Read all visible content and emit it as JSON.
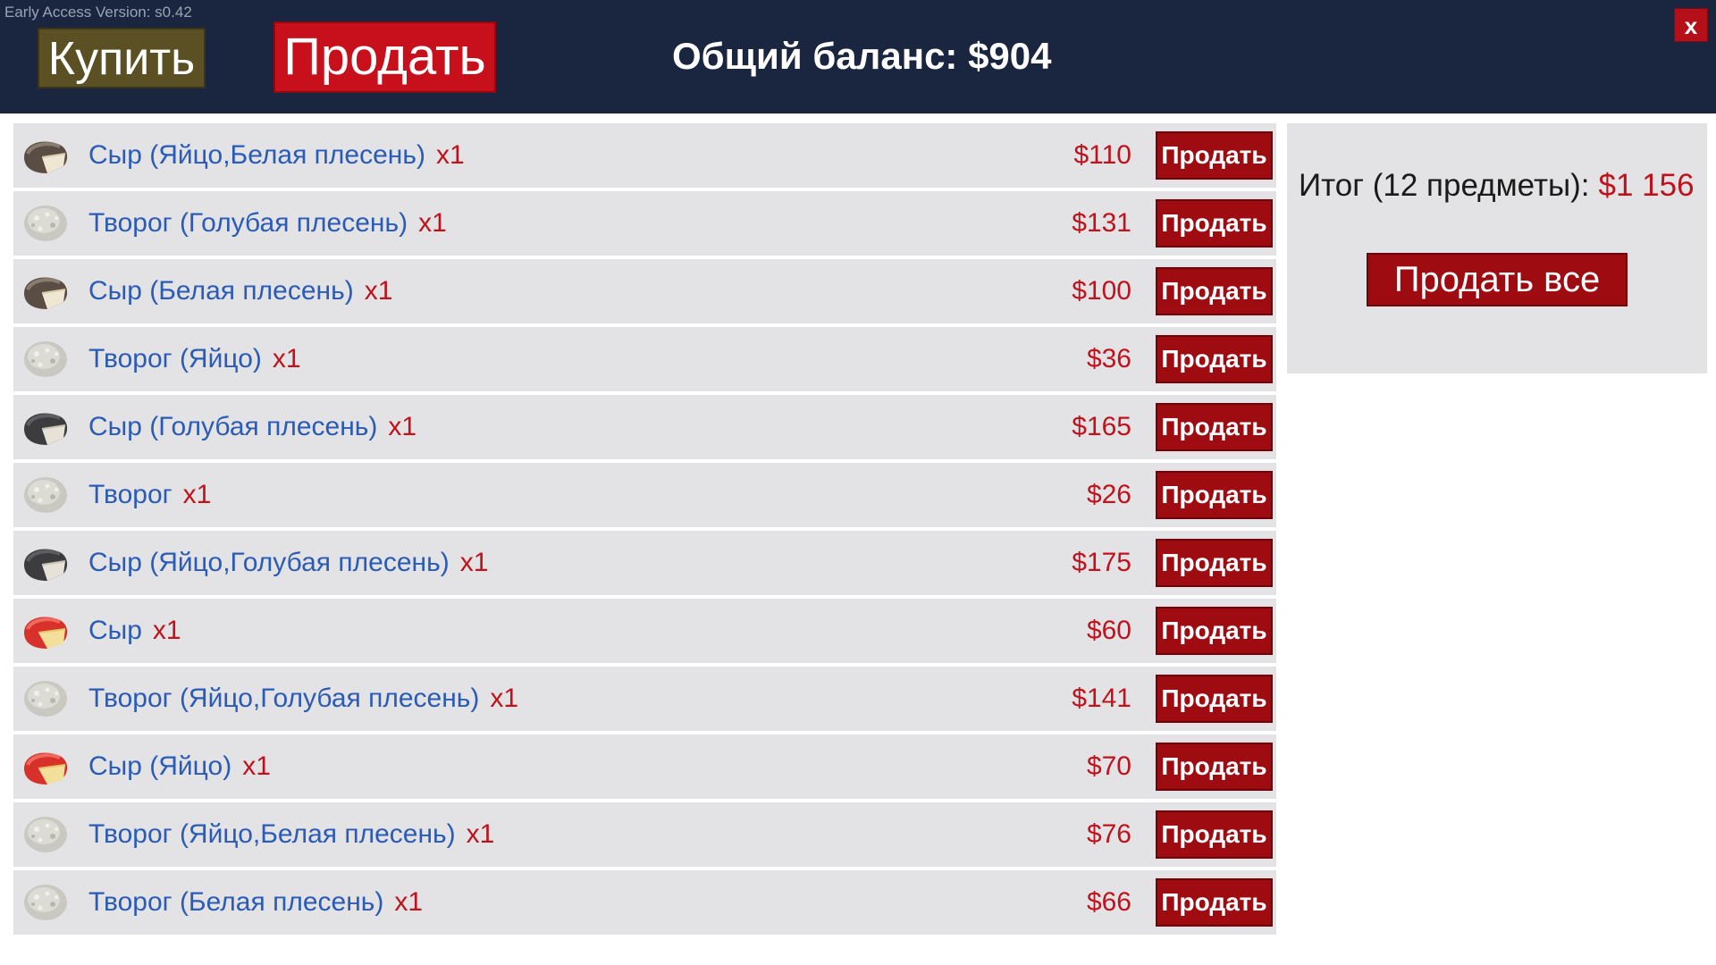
{
  "version_label": "Early Access Version: s0.42",
  "tabs": {
    "buy_label": "Купить",
    "sell_label": "Продать"
  },
  "balance_label": "Общий баланс: $904",
  "close_label": "x",
  "colors": {
    "topbar": "#1a2540",
    "buy_tab": "#5b5023",
    "sell_tab_active": "#c8101c",
    "row_button": "#9e0c12",
    "item_name": "#2a5bb6",
    "price": "#c0121c",
    "row_background": "#e3e3e5"
  },
  "items": [
    {
      "name": "Сыр (Яйцо,Белая плесень)",
      "qty": "x1",
      "price": "$110",
      "button": "Продать",
      "icon": "cheese-white-mold-icon"
    },
    {
      "name": "Творог (Голубая плесень)",
      "qty": "x1",
      "price": "$131",
      "button": "Продать",
      "icon": "cottage-cheese-icon"
    },
    {
      "name": "Сыр (Белая плесень)",
      "qty": "x1",
      "price": "$100",
      "button": "Продать",
      "icon": "cheese-white-mold-icon"
    },
    {
      "name": "Творог (Яйцо)",
      "qty": "x1",
      "price": "$36",
      "button": "Продать",
      "icon": "cottage-cheese-icon"
    },
    {
      "name": "Сыр (Голубая плесень)",
      "qty": "x1",
      "price": "$165",
      "button": "Продать",
      "icon": "cheese-blue-mold-icon"
    },
    {
      "name": "Творог",
      "qty": "x1",
      "price": "$26",
      "button": "Продать",
      "icon": "cottage-cheese-icon"
    },
    {
      "name": "Сыр (Яйцо,Голубая плесень)",
      "qty": "x1",
      "price": "$175",
      "button": "Продать",
      "icon": "cheese-blue-mold-icon"
    },
    {
      "name": "Сыр",
      "qty": "x1",
      "price": "$60",
      "button": "Продать",
      "icon": "cheese-red-wax-icon"
    },
    {
      "name": "Творог (Яйцо,Голубая плесень)",
      "qty": "x1",
      "price": "$141",
      "button": "Продать",
      "icon": "cottage-cheese-icon"
    },
    {
      "name": "Сыр (Яйцо)",
      "qty": "x1",
      "price": "$70",
      "button": "Продать",
      "icon": "cheese-red-wax-icon"
    },
    {
      "name": "Творог (Яйцо,Белая плесень)",
      "qty": "x1",
      "price": "$76",
      "button": "Продать",
      "icon": "cottage-cheese-icon"
    },
    {
      "name": "Творог (Белая плесень)",
      "qty": "x1",
      "price": "$66",
      "button": "Продать",
      "icon": "cottage-cheese-icon"
    }
  ],
  "summary": {
    "label": "Итог (12 предметы):",
    "total": "$1 156",
    "sell_all_label": "Продать все"
  }
}
